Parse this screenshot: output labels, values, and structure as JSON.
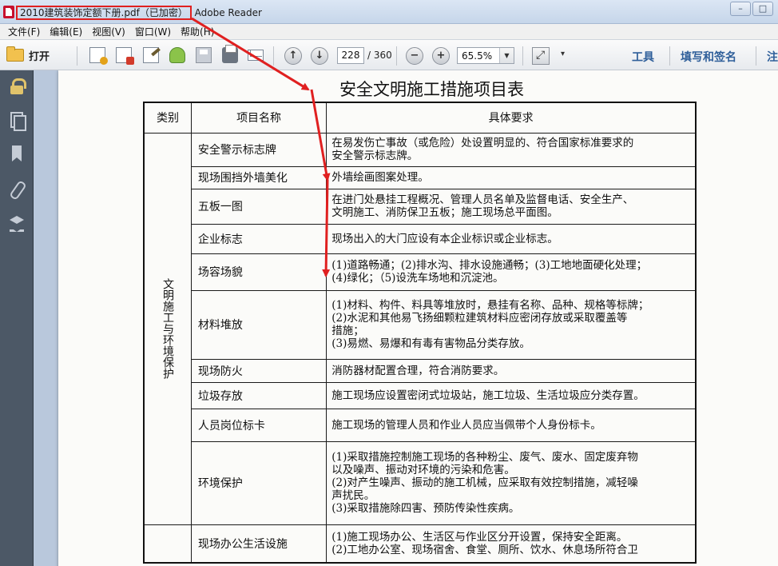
{
  "window": {
    "file_name": "2010建筑装饰定额下册.pdf（已加密）",
    "app_name": "Adobe Reader",
    "controls": [
      "–",
      "□",
      "✕"
    ]
  },
  "menu": [
    "文件(F)",
    "编辑(E)",
    "视图(V)",
    "窗口(W)",
    "帮助(H)"
  ],
  "toolbar": {
    "open_label": "打开",
    "page_current": "228",
    "page_total": "/ 360",
    "zoom_value": "65.5%",
    "tools_label": "工具",
    "fill_sign_label": "填写和签名",
    "comment_label": "注"
  },
  "colors": {
    "annotation": "#e02020",
    "nav_bg": "#4c5866",
    "link_blue": "#2f5f9a"
  },
  "document": {
    "title": "安全文明施工措施项目表",
    "headers": [
      "类别",
      "项目名称",
      "具体要求"
    ],
    "category": "文明施工与环境保护",
    "rows": [
      {
        "name": "安全警示标志牌",
        "lines": [
          "在易发伤亡事故（或危险）处设置明显的、符合国家标准要求的",
          "安全警示标志牌。"
        ]
      },
      {
        "name": "现场围挡外墙美化",
        "lines": [
          "外墙绘画图案处理。"
        ]
      },
      {
        "name": "五板一图",
        "lines": [
          "在进门处悬挂工程概况、管理人员名单及监督电话、安全生产、",
          "文明施工、消防保卫五板；施工现场总平面图。"
        ]
      },
      {
        "name": "企业标志",
        "lines": [
          "现场出入的大门应设有本企业标识或企业标志。"
        ]
      },
      {
        "name": "场容场貌",
        "lines": [
          "(1)道路畅通；(2)排水沟、排水设施通畅；(3)工地地面硬化处理；",
          "(4)绿化；（5)设洗车场地和沉淀池。"
        ]
      },
      {
        "name": "材料堆放",
        "lines": [
          "(1)材料、构件、料具等堆放时，悬挂有名称、品种、规格等标牌；",
          "(2)水泥和其他易飞扬细颗粒建筑材料应密闭存放或采取覆盖等",
          "措施；",
          "(3)易燃、易爆和有毒有害物品分类存放。"
        ]
      },
      {
        "name": "现场防火",
        "lines": [
          "消防器材配置合理，符合消防要求。"
        ]
      },
      {
        "name": "垃圾存放",
        "lines": [
          "施工现场应设置密闭式垃圾站，施工垃圾、生活垃圾应分类存置。"
        ]
      },
      {
        "name": "人员岗位标卡",
        "lines": [
          "施工现场的管理人员和作业人员应当佩带个人身份标卡。"
        ]
      },
      {
        "name": "环境保护",
        "lines": [
          "(1)采取措施控制施工现场的各种粉尘、废气、废水、固定废弃物",
          "以及噪声、振动对环境的污染和危害。",
          "(2)对产生噪声、振动的施工机械，应采取有效控制措施，减轻噪",
          "声扰民。",
          "(3)采取措施除四害、预防传染性疾病。"
        ]
      },
      {
        "name": "现场办公生活设施",
        "lines": [
          "(1)施工现场办公、生活区与作业区分开设置，保持安全距离。",
          "(2)工地办公室、现场宿舍、食堂、厕所、饮水、休息场所符合卫"
        ]
      }
    ]
  }
}
